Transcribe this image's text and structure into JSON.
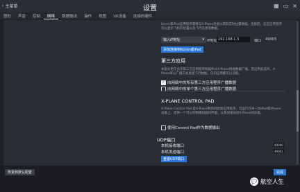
{
  "header": {
    "back_label": "主菜单",
    "title": "设置",
    "icons": [
      "grid-icon",
      "monitor-icon",
      "close-icon"
    ]
  },
  "tabs": [
    "图形",
    "声音",
    "控制",
    "网络",
    "数据输出",
    "操作",
    "视图",
    "VR设备",
    "连接的硬件"
  ],
  "active_tab": 3,
  "ext_device": {
    "description": "Koren和iPad应用程序需要与X-Plane连接以获取实时位置数据。连接后，这些应用程序可以显示飞机的位置以及飞行信息等数据。",
    "select_label": "输入IP地址",
    "ip_label": "IP地址",
    "ip_value": "192.168.1.3",
    "port_label": "端口",
    "port_value": "49003",
    "add_button": "添加连接到Koren或iPad"
  },
  "third_party": {
    "title": "第三方应用",
    "description": "本部分用于允许第三方应用程序和插件从X-Plane接收数据广播。若启用此选项，X-Plane将以广播方式发送飞行数据，任何应用都可以读取。",
    "checkbox1": "向网络中的所有第三方应用程序广播数据",
    "checkbox1_checked": true,
    "checkbox2": "向网络中的单个第三方应用程序广播数据",
    "checkbox2_checked": false
  },
  "control_pad": {
    "title": "X-PLANE CONTROL PAD",
    "description": "X-Plane Control Pad 是X-Plane制作的配套应用程序，可运行在另一台iPad或iPhone设备上，提供一个可以控制模拟器的界面，以及快速访问X-Plane的功能。",
    "checkbox": "使用Control Pad作为数据输出",
    "checkbox_checked": false
  },
  "udp": {
    "title": "UDP端口",
    "recv_label": "本机接收端口",
    "recv_value": "49000",
    "send_label": "本机发送端口",
    "send_value": "49001",
    "reset_button": "重置UDP端口"
  },
  "footer": {
    "restore_button": "恢复到默认配置",
    "done_button": "完成"
  },
  "watermark": {
    "badge": "💬",
    "text": "航空人生"
  }
}
